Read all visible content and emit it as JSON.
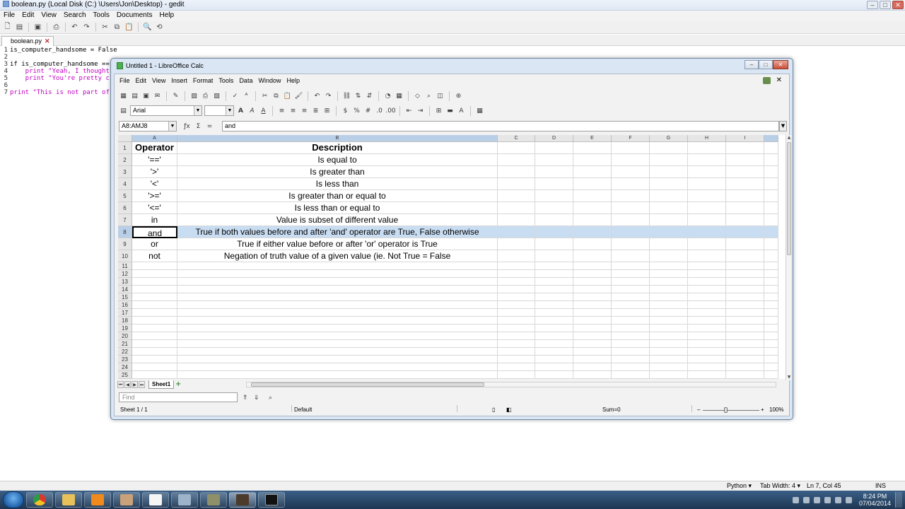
{
  "gedit": {
    "title": "boolean.py (Local Disk (C:) \\Users\\Jon\\Desktop) - gedit",
    "menu": [
      "File",
      "Edit",
      "View",
      "Search",
      "Tools",
      "Documents",
      "Help"
    ],
    "tab_label": "boolean.py",
    "code": [
      {
        "n": "1",
        "text": "is_computer_handsome = False"
      },
      {
        "n": "2",
        "text": ""
      },
      {
        "n": "3",
        "text": "if is_computer_handsome =="
      },
      {
        "n": "4",
        "text": "    print \"Yeah, I thought"
      },
      {
        "n": "5",
        "text": "    print \"You're pretty c"
      },
      {
        "n": "6",
        "text": ""
      },
      {
        "n": "7",
        "text": "print \"This is not part of"
      }
    ],
    "status": {
      "language": "Python ▾",
      "tab_width": "Tab Width: 4 ▾",
      "cursor": "Ln 7, Col 45",
      "mode": "INS"
    }
  },
  "calc": {
    "title": "Untitled 1 - LibreOffice Calc",
    "menu": [
      "File",
      "Edit",
      "View",
      "Insert",
      "Format",
      "Tools",
      "Data",
      "Window",
      "Help"
    ],
    "font_name": "Arial",
    "font_size": "",
    "name_box": "A8:AMJ8",
    "formula": "and",
    "columns": [
      "A",
      "B",
      "C",
      "D",
      "E",
      "F",
      "G",
      "H",
      "I"
    ],
    "row_numbers": [
      "1",
      "2",
      "3",
      "4",
      "5",
      "6",
      "7",
      "8",
      "9",
      "10",
      "11",
      "12",
      "13",
      "14",
      "15",
      "16",
      "17",
      "18",
      "19",
      "20",
      "21",
      "22",
      "23",
      "24",
      "25"
    ],
    "table": {
      "headers": [
        "Operator",
        "Description"
      ],
      "rows": [
        [
          "'=='",
          "Is equal to"
        ],
        [
          "'>'",
          "Is greater than"
        ],
        [
          "'<'",
          "Is less than"
        ],
        [
          "'>='",
          "Is greater than or equal to"
        ],
        [
          "'<='",
          "Is less than or equal to"
        ],
        [
          "in",
          "Value is subset of different value"
        ],
        [
          "and",
          "True if both values before and after 'and' operator are True, False otherwise"
        ],
        [
          "or",
          "True if either value before or after 'or' operator is True"
        ],
        [
          "not",
          "Negation of truth value of a given value (ie. Not True = False"
        ]
      ]
    },
    "selected_row": "8",
    "sheet_tab": "Sheet1",
    "find_placeholder": "Find",
    "status": {
      "sheet": "Sheet 1 / 1",
      "style": "Default",
      "sum": "Sum=0",
      "zoom": "100%"
    }
  },
  "taskbar": {
    "clock_time": "8:24 PM",
    "clock_date": "07/04/2014",
    "apps": [
      "chrome-icon",
      "explorer-icon",
      "media-player-icon",
      "photo-icon",
      "notepad-icon",
      "pen-icon",
      "files-icon",
      "game-icon",
      "terminal-icon"
    ]
  }
}
